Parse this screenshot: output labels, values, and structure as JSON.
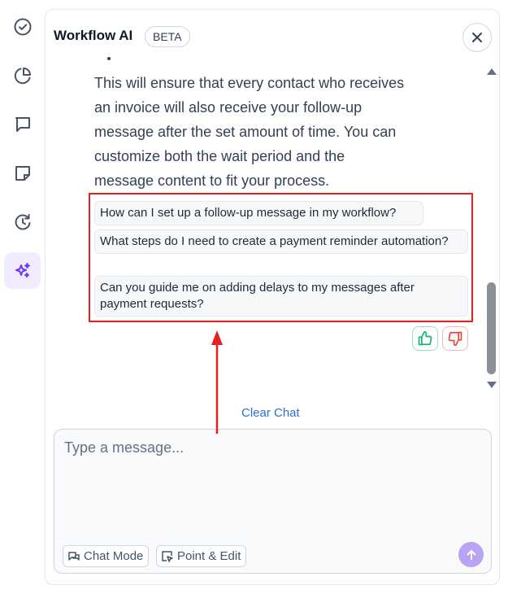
{
  "header": {
    "title": "Workflow AI",
    "badge": "BETA"
  },
  "sidebar": {
    "items": [
      {
        "name": "tasks",
        "icon": "check-circle-icon",
        "active": false
      },
      {
        "name": "reports",
        "icon": "pie-chart-icon",
        "active": false
      },
      {
        "name": "conversations",
        "icon": "chat-bubble-icon",
        "active": false
      },
      {
        "name": "notes",
        "icon": "sticky-note-icon",
        "active": false
      },
      {
        "name": "history",
        "icon": "clock-refresh-icon",
        "active": false
      },
      {
        "name": "workflow-ai",
        "icon": "sparkles-icon",
        "active": true
      }
    ]
  },
  "message": {
    "lines": [
      "This will ensure that every contact who receives",
      "an invoice will also receive your follow-up",
      "message after the set amount of time. You can",
      "customize both the wait period and the",
      "message content to fit your process."
    ]
  },
  "suggestions": [
    "How can I set up a follow-up message in my workflow?",
    "What steps do I need to create a payment reminder automation?",
    "Can you guide me on adding delays to my messages after payment requests?"
  ],
  "feedback": {
    "up_icon": "thumbs-up-icon",
    "down_icon": "thumbs-down-icon"
  },
  "clear_chat": "Clear Chat",
  "composer": {
    "placeholder": "Type a message...",
    "chat_mode_label": "Chat Mode",
    "point_edit_label": "Point & Edit"
  },
  "colors": {
    "accent": "#6d3bf5",
    "send_button": "#b9a3f5",
    "annotation_red": "#e5201f",
    "link": "#2f6fd6"
  }
}
